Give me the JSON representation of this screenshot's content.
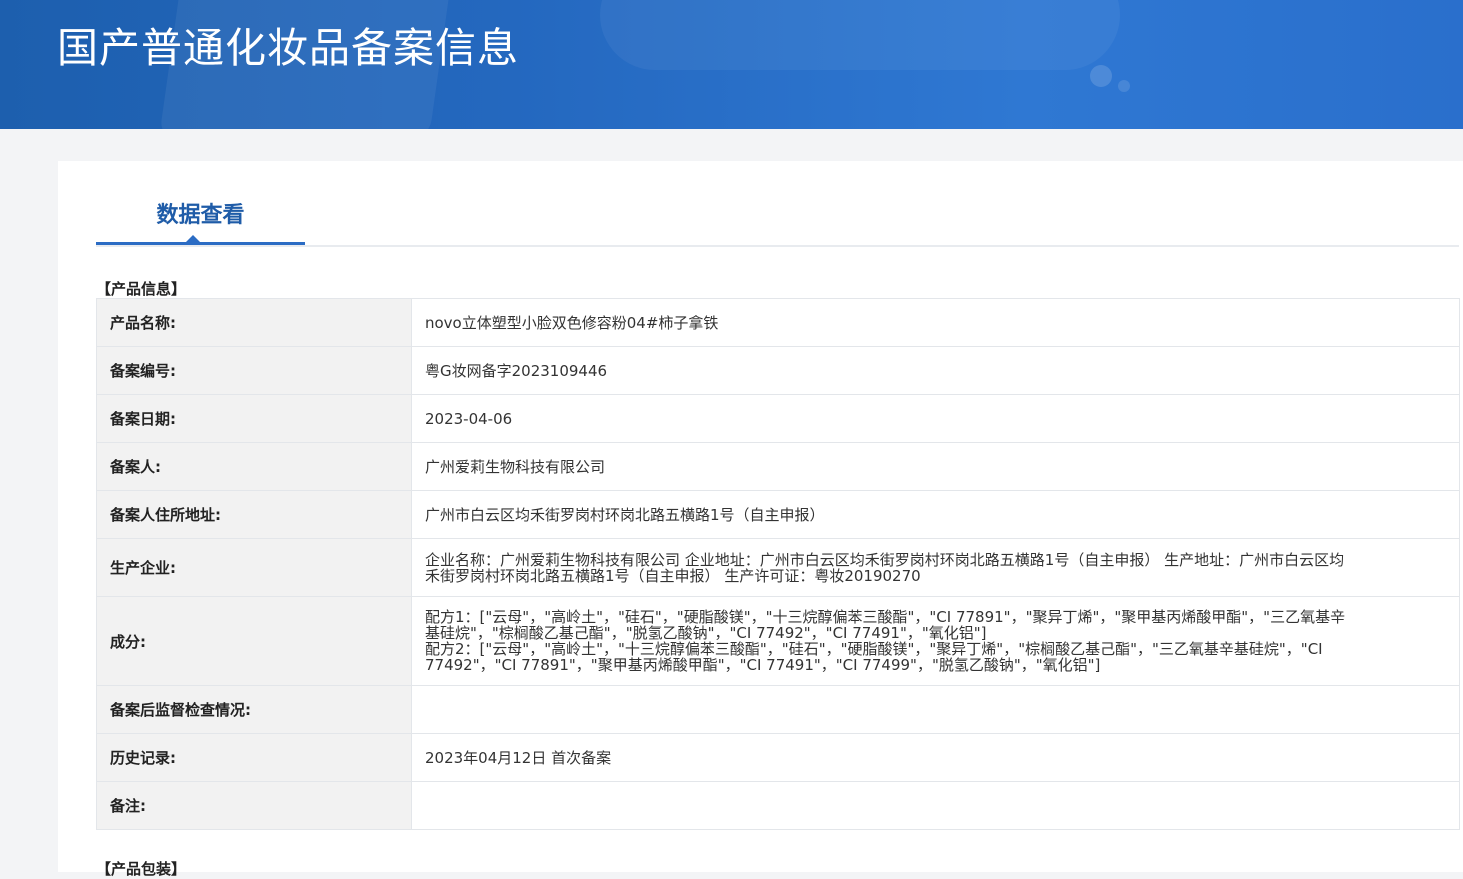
{
  "banner": {
    "title": "国产普通化妆品备案信息"
  },
  "tabs": [
    {
      "label": "数据查看"
    }
  ],
  "sections": {
    "product_info": "【产品信息】",
    "product_packaging": "【产品包装】"
  },
  "rows": [
    {
      "label": "产品名称:",
      "value": "novo立体塑型小脸双色修容粉04#柿子拿铁"
    },
    {
      "label": "备案编号:",
      "value": "粤G妆网备字2023109446"
    },
    {
      "label": "备案日期:",
      "value": "2023-04-06"
    },
    {
      "label": "备案人:",
      "value": "广州爱莉生物科技有限公司"
    },
    {
      "label": "备案人住所地址:",
      "value": "广州市白云区均禾街罗岗村环岗北路五横路1号（自主申报）"
    },
    {
      "label": "生产企业:",
      "lines": [
        "企业名称：广州爱莉生物科技有限公司 企业地址：广州市白云区均禾街罗岗村环岗北路五横路1号（自主申报） 生产地址：广州市白云区均",
        "禾街罗岗村环岗北路五横路1号（自主申报） 生产许可证：粤妆20190270"
      ]
    },
    {
      "label": "成分:",
      "lines": [
        "配方1：[\"云母\"，\"高岭土\"，\"硅石\"，\"硬脂酸镁\"，\"十三烷醇偏苯三酸酯\"，\"CI 77891\"，\"聚异丁烯\"，\"聚甲基丙烯酸甲酯\"，\"三乙氧基辛",
        "基硅烷\"，\"棕榈酸乙基己酯\"，\"脱氢乙酸钠\"，\"CI 77492\"，\"CI 77491\"，\"氧化铝\"]",
        "配方2：[\"云母\"，\"高岭土\"，\"十三烷醇偏苯三酸酯\"，\"硅石\"，\"硬脂酸镁\"，\"聚异丁烯\"，\"棕榈酸乙基己酯\"，\"三乙氧基辛基硅烷\"，\"CI",
        "77492\"，\"CI 77891\"，\"聚甲基丙烯酸甲酯\"，\"CI 77491\"，\"CI 77499\"，\"脱氢乙酸钠\"，\"氧化铝\"]"
      ]
    },
    {
      "label": "备案后监督检查情况:",
      "value": ""
    },
    {
      "label": "历史记录:",
      "value": "2023年04月12日 首次备案"
    },
    {
      "label": "备注:",
      "value": ""
    }
  ]
}
